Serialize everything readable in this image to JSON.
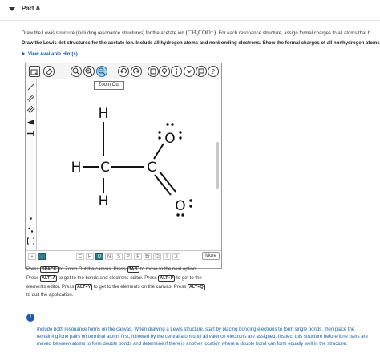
{
  "part": {
    "title": "Part A"
  },
  "question": {
    "desc_before": "Draw the Lewis structure (including resonance structures) for the acetate ion ",
    "formula": "(CH₃COO⁻)",
    "desc_after": ". For each resonance structure, assign formal charges to all atoms that h",
    "instruction": "Draw the Lewis dot structures for the acetate ion. Include all hydrogen atoms and nonbonding electrons. Show the formal charges of all nonhydrogen atoms"
  },
  "hints_link": "View Available Hint(s)",
  "toolbar": {
    "tooltip": "Zoom Out",
    "more_label": "More"
  },
  "molecule": {
    "h_top": "H",
    "h_left": "H",
    "c1": "C",
    "c2": "C",
    "h_bottom": "H",
    "o_top": "O",
    "o_bottom": "O"
  },
  "elements": [
    "C",
    "H",
    "O",
    "N",
    "S",
    "P",
    "F",
    "Br",
    "Cl",
    "I",
    "X"
  ],
  "element_prefix": [
    "+",
    "-"
  ],
  "keyboard_help": {
    "l1a": "Press ",
    "k_space": "SPACE",
    "l1b": " to Zoom Out the canvas. Press ",
    "k_tab": "TAB",
    "l1c": " to move to the next option.",
    "l2a": "Press ",
    "k_alta": "ALT+A",
    "l2b": " to get to the bonds and electrons editor. Press ",
    "k_altp": "ALT+P",
    "l2c": " to get to the",
    "l3a": "elements editor. Press ",
    "k_alty": "ALT+Y",
    "l3b": " to get to the elements on the canvas. Press ",
    "k_altq": "ALT+Q",
    "l4": "to quit the application."
  },
  "hint_box": {
    "icon": "!",
    "text": "Include both resonance forms on the canvas. When drawing a Lewis structure, start by placing bonding electrons to form single bonds, then place the remaining lone pairs on terminal atoms first, followed by the central atom until all valence electrons are assigned. Inspect this structure before lone pairs are moved between atoms to form double bonds and determine if there is another location where a double bond can form equally well in the structure."
  },
  "colors": {
    "accent": "#1a5fa8",
    "oxygen_button": "#2d7d8a",
    "carbon_selected": "#5e9e3d"
  }
}
